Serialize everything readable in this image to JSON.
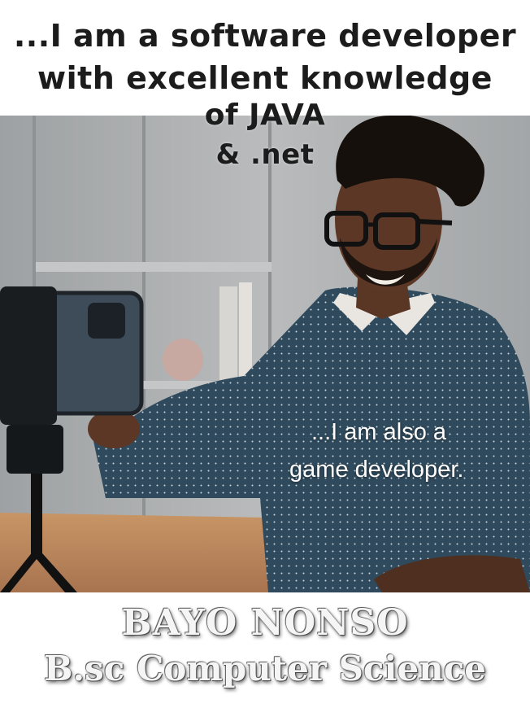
{
  "header": {
    "line1": "...I am a software developer",
    "line2": "with excellent knowledge",
    "line3": "of JAVA",
    "line4": "& .net"
  },
  "photo": {
    "caption_line1": "...I am also a",
    "caption_line2": "game developer."
  },
  "footer": {
    "name": "BAYO NONSO",
    "degree": "B.sc Computer Science"
  },
  "colors": {
    "headline": "#1c1c1c",
    "caption": "#ffffff",
    "footer_text": "#f5f5f5",
    "shirt": "#2f4a5c",
    "desk": "#b8835a",
    "wall": "#aeb0b1"
  }
}
